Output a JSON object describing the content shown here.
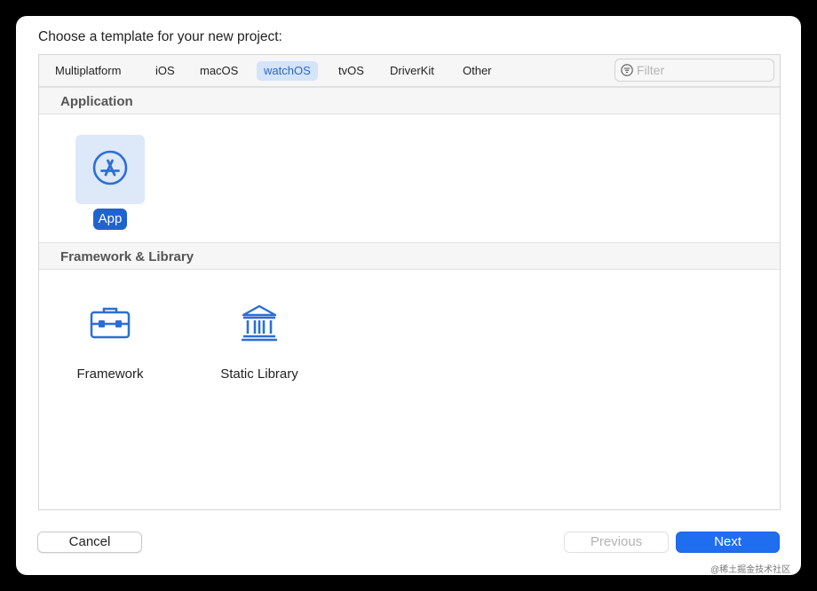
{
  "dialog": {
    "title": "Choose a template for your new project:"
  },
  "tabs": [
    {
      "label": "Multiplatform",
      "selected": false
    },
    {
      "label": "iOS",
      "selected": false
    },
    {
      "label": "macOS",
      "selected": false
    },
    {
      "label": "watchOS",
      "selected": true
    },
    {
      "label": "tvOS",
      "selected": false
    },
    {
      "label": "DriverKit",
      "selected": false
    },
    {
      "label": "Other",
      "selected": false
    }
  ],
  "filter": {
    "placeholder": "Filter",
    "value": "",
    "icon": "filter-icon"
  },
  "sections": [
    {
      "header": "Application",
      "templates": [
        {
          "label": "App",
          "icon": "app-store-icon",
          "selected": true
        }
      ]
    },
    {
      "header": "Framework & Library",
      "templates": [
        {
          "label": "Framework",
          "icon": "toolbox-icon",
          "selected": false
        },
        {
          "label": "Static Library",
          "icon": "library-building-icon",
          "selected": false
        }
      ]
    }
  ],
  "buttons": {
    "cancel": "Cancel",
    "previous": "Previous",
    "next": "Next"
  },
  "colors": {
    "accent": "#1f6ef0",
    "selected_tab_bg": "#d3e4fb",
    "selected_tile_bg": "#dde8f8",
    "icon_blue": "#2b6fd6"
  },
  "watermark": "@稀土掘金技术社区"
}
